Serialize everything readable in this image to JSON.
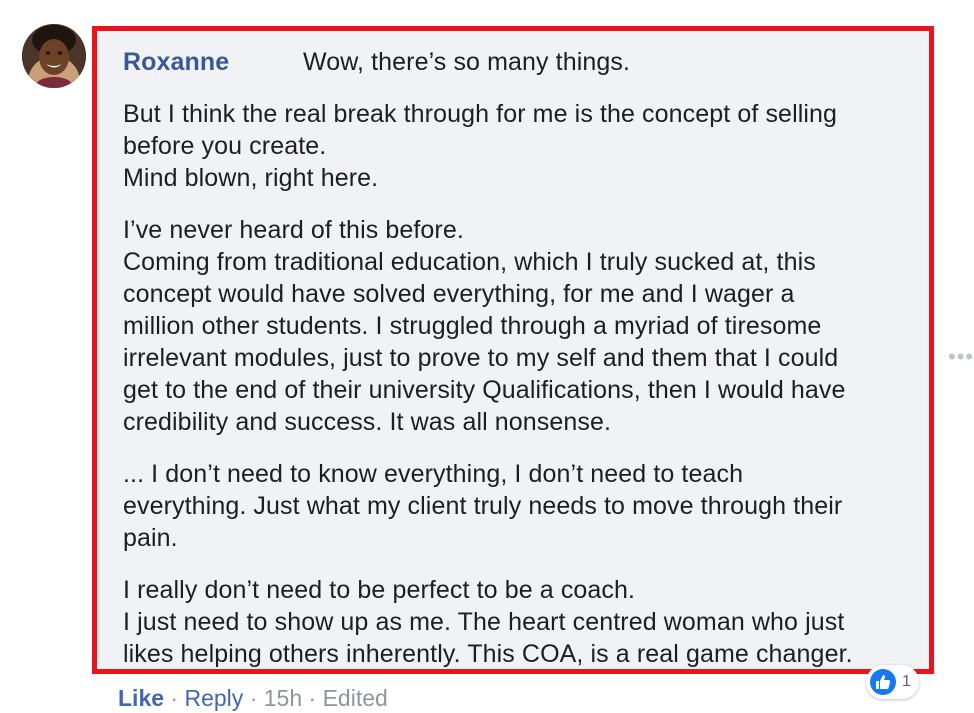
{
  "comment": {
    "author": "Roxanne",
    "first_line": "Wow, there’s so many things.",
    "paragraphs": [
      [
        "But I think the real break through for me is the concept of selling",
        "before you create.",
        "Mind blown, right here."
      ],
      [
        "I’ve never heard of this before.",
        "Coming from traditional education, which I truly sucked at, this",
        "concept would have solved everything, for me and I wager a",
        "million other students. I struggled through a myriad of tiresome",
        "irrelevant modules, just to prove to my self and them that I could",
        "get to the end of their university Qualifications, then I would have",
        "credibility and success. It was all nonsense."
      ],
      [
        "... I don’t need to know everything, I don’t need to teach",
        "everything. Just what my client truly needs to move through their",
        "pain."
      ],
      [
        "I really don’t need to be perfect to be a coach.",
        "I just need to show up as me. The heart centred woman who just",
        "likes helping others inherently. This COA, is a real game changer."
      ]
    ]
  },
  "actions": {
    "like_label": "Like",
    "separator": "·",
    "reply_label": "Reply",
    "time": "15h",
    "edited": "Edited"
  },
  "reactions": {
    "icon": "thumbs-up-icon",
    "count": "1",
    "color": "#1877f2"
  },
  "more": {
    "icon": "more-options-icon",
    "glyph": "•••"
  },
  "highlight_color": "#e8161c",
  "bubble_color": "#f0f2f5",
  "author_color": "#385898"
}
